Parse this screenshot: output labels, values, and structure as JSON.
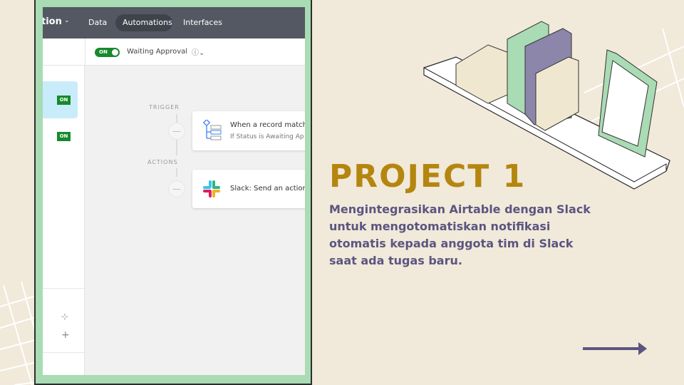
{
  "app": {
    "base_name_partial": "tion",
    "nav": [
      "Data",
      "Automations",
      "Interfaces"
    ],
    "active_nav": "Automations"
  },
  "automation": {
    "toggle": "ON",
    "name": "Waiting Approval"
  },
  "sidebar": {
    "badges": [
      "ON",
      "ON"
    ]
  },
  "flow": {
    "trigger_label": "TRIGGER",
    "actions_label": "ACTIONS",
    "trigger_title": "When a record matche",
    "trigger_sub": "If Status is Awaiting Ap",
    "action_title": "Slack: Send an actiona"
  },
  "slide": {
    "title": "PROJECT 1",
    "description": [
      "Mengintegrasikan Airtable  dengan Slack",
      "untuk mengotomatiskan  notifikasi",
      "otomatis kepada anggota tim di Slack",
      "saat ada tugas baru."
    ]
  },
  "colors": {
    "background": "#f1e9da",
    "title": "#b5860f",
    "text": "#5b5580",
    "frame": "#a9dbb4",
    "toggle_on": "#168a2c"
  }
}
